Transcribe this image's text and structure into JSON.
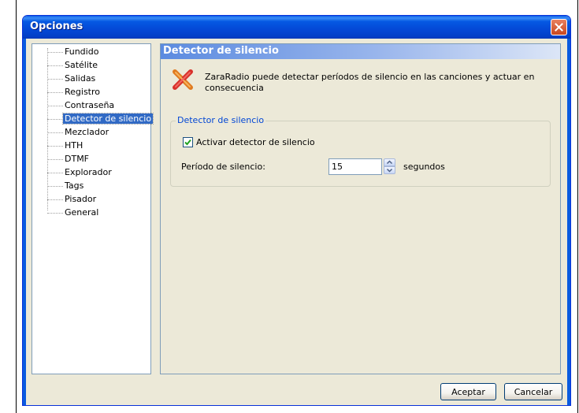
{
  "window": {
    "title": "Opciones"
  },
  "tree": {
    "items": [
      {
        "label": "Fundido"
      },
      {
        "label": "Satélite"
      },
      {
        "label": "Salidas"
      },
      {
        "label": "Registro"
      },
      {
        "label": "Contraseña"
      },
      {
        "label": "Detector de silencio",
        "selected": true
      },
      {
        "label": "Mezclador"
      },
      {
        "label": "HTH"
      },
      {
        "label": "DTMF"
      },
      {
        "label": "Explorador"
      },
      {
        "label": "Tags"
      },
      {
        "label": "Pisador"
      },
      {
        "label": "General"
      }
    ]
  },
  "panel": {
    "header": "Detector de silencio",
    "info_icon": "crossed-tools-icon",
    "info_text": "ZaraRadio puede detectar períodos de silencio en las canciones y actuar en consecuencia",
    "group": {
      "title": "Detector de silencio",
      "checkbox_label": "Activar detector de silencio",
      "checkbox_checked": true,
      "period_label": "Período de silencio:",
      "period_value": "15",
      "unit": "segundos"
    }
  },
  "buttons": {
    "ok": "Aceptar",
    "cancel": "Cancelar"
  },
  "colors": {
    "titlebar": "#0448D6",
    "window_bg": "#ECE9D8",
    "selection": "#316AC5",
    "group_title": "#0046D5"
  }
}
